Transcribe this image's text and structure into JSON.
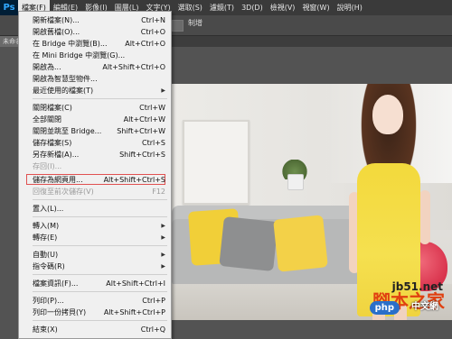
{
  "menubar": {
    "logo": "Ps",
    "items": [
      "檔案(F)",
      "編輯(E)",
      "影像(I)",
      "圖層(L)",
      "文字(Y)",
      "選取(S)",
      "濾鏡(T)",
      "3D(D)",
      "檢視(V)",
      "視窗(W)",
      "說明(H)"
    ]
  },
  "options_bar": {
    "right_label": "制增"
  },
  "document_tab": {
    "label": "未命名"
  },
  "file_menu": {
    "items": [
      {
        "label": "開新檔案(N)...",
        "shortcut": "Ctrl+N"
      },
      {
        "label": "開啟舊檔(O)...",
        "shortcut": "Ctrl+O"
      },
      {
        "label": "在 Bridge 中瀏覽(B)...",
        "shortcut": "Alt+Ctrl+O"
      },
      {
        "label": "在 Mini Bridge 中瀏覽(G)...",
        "shortcut": ""
      },
      {
        "label": "開啟為...",
        "shortcut": "Alt+Shift+Ctrl+O"
      },
      {
        "label": "開啟為智慧型物件...",
        "shortcut": ""
      },
      {
        "label": "最近使用的檔案(T)",
        "shortcut": ""
      },
      {
        "label": "關閉檔案(C)",
        "shortcut": "Ctrl+W"
      },
      {
        "label": "全部關閉",
        "shortcut": "Alt+Ctrl+W"
      },
      {
        "label": "關閉並跳至 Bridge...",
        "shortcut": "Shift+Ctrl+W"
      },
      {
        "label": "儲存檔案(S)",
        "shortcut": "Ctrl+S"
      },
      {
        "label": "另存新檔(A)...",
        "shortcut": "Shift+Ctrl+S"
      },
      {
        "label": "存回(I)...",
        "shortcut": ""
      },
      {
        "label": "儲存為網頁用...",
        "shortcut": "Alt+Shift+Ctrl+S"
      },
      {
        "label": "回復至前次儲存(V)",
        "shortcut": "F12"
      },
      {
        "label": "置入(L)...",
        "shortcut": ""
      },
      {
        "label": "轉入(M)",
        "shortcut": ""
      },
      {
        "label": "轉存(E)",
        "shortcut": ""
      },
      {
        "label": "自動(U)",
        "shortcut": ""
      },
      {
        "label": "指令碼(R)",
        "shortcut": ""
      },
      {
        "label": "檔案資訊(F)...",
        "shortcut": "Alt+Shift+Ctrl+I"
      },
      {
        "label": "列印(P)...",
        "shortcut": "Ctrl+P"
      },
      {
        "label": "列印一份拷貝(Y)",
        "shortcut": "Alt+Shift+Ctrl+P"
      },
      {
        "label": "結束(X)",
        "shortcut": "Ctrl+Q"
      }
    ]
  },
  "watermarks": {
    "jb51": "jb51.net",
    "jiaoben": "腳本之家",
    "php": "php",
    "cn": "中文網"
  },
  "colors": {
    "highlight_border": "#e05050",
    "menubar_bg": "#3a3a3a"
  }
}
